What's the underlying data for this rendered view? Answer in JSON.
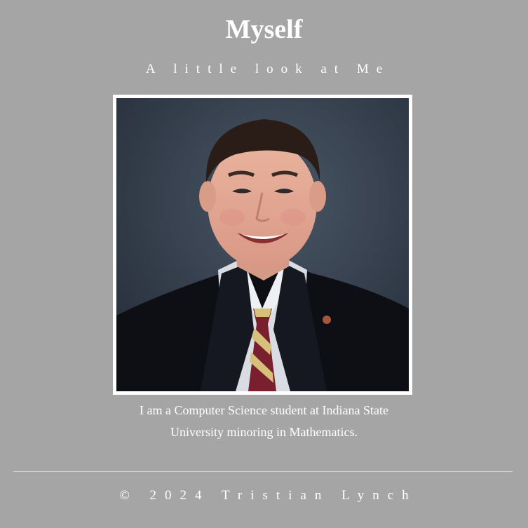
{
  "header": {
    "title": "Myself",
    "subtitle": "A little look at Me"
  },
  "profile": {
    "photo_alt": "Portrait photo",
    "bio_line_1": "I am a Computer Science student at Indiana State",
    "bio_line_2": "University minoring in Mathematics."
  },
  "footer": {
    "copyright": "© 2024 Tristian Lynch"
  },
  "colors": {
    "background": "#a5a5a5",
    "text": "#ffffff",
    "frame": "#ffffff",
    "divider": "#d4d4d4"
  }
}
